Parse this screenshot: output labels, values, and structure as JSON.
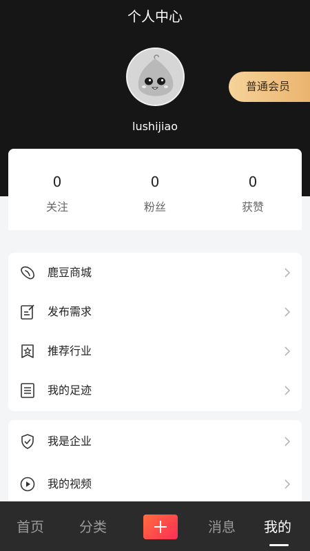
{
  "header": {
    "title": "个人中心",
    "username": "lushijiao",
    "member_label": "普通会员"
  },
  "stats": [
    {
      "value": "0",
      "label": "关注"
    },
    {
      "value": "0",
      "label": "粉丝"
    },
    {
      "value": "0",
      "label": "获赞"
    }
  ],
  "menu_group_1": [
    {
      "label": "鹿豆商城",
      "icon": "bean-icon"
    },
    {
      "label": "发布需求",
      "icon": "edit-note-icon"
    },
    {
      "label": "推荐行业",
      "icon": "star-bookmark-icon"
    },
    {
      "label": "我的足迹",
      "icon": "document-lines-icon"
    }
  ],
  "menu_group_2": [
    {
      "label": "我是企业",
      "icon": "shield-check-icon"
    },
    {
      "label": "我的视频",
      "icon": "play-circle-icon"
    }
  ],
  "bottom_nav": {
    "home": "首页",
    "category": "分类",
    "messages": "消息",
    "mine": "我的",
    "active": "mine"
  },
  "colors": {
    "header_bg": "#161616",
    "page_bg": "#f4f5f7",
    "member_gradient_start": "#f6d39a",
    "member_gradient_end": "#e9b16a",
    "add_button_start": "#ff6d3e",
    "add_button_end": "#ff2d55",
    "nav_bg": "#2b2b2b"
  }
}
